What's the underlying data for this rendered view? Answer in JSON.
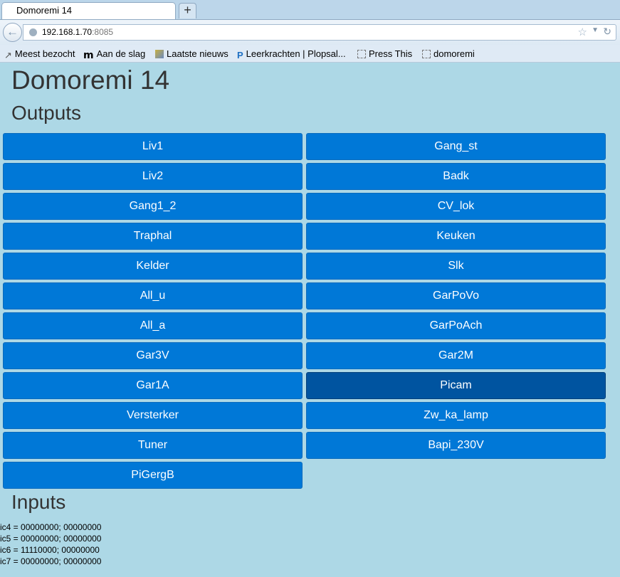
{
  "browser": {
    "tab_title": "Domoremi 14",
    "new_tab": "+",
    "url_host": "192.168.1.70",
    "url_port": ":8085",
    "bookmarks": [
      {
        "label": "Meest bezocht",
        "icon": "most-visited-icon"
      },
      {
        "label": "Aan de slag",
        "icon": "m-logo-icon"
      },
      {
        "label": "Laatste nieuws",
        "icon": "news-feed-icon"
      },
      {
        "label": "Leerkrachten | Plopsal...",
        "icon": "p-logo-icon"
      },
      {
        "label": "Press This",
        "icon": "blank-page-icon"
      },
      {
        "label": "domoremi",
        "icon": "blank-page-icon"
      }
    ]
  },
  "page": {
    "title": "Domoremi 14",
    "outputs_heading": "Outputs",
    "inputs_heading": "Inputs",
    "outputs": [
      {
        "label": "Liv1",
        "active": false
      },
      {
        "label": "Gang_st",
        "active": false
      },
      {
        "label": "Liv2",
        "active": false
      },
      {
        "label": "Badk",
        "active": false
      },
      {
        "label": "Gang1_2",
        "active": false
      },
      {
        "label": "CV_lok",
        "active": false
      },
      {
        "label": "Traphal",
        "active": false
      },
      {
        "label": "Keuken",
        "active": false
      },
      {
        "label": "Kelder",
        "active": false
      },
      {
        "label": "Slk",
        "active": false
      },
      {
        "label": "All_u",
        "active": false
      },
      {
        "label": "GarPoVo",
        "active": false
      },
      {
        "label": "All_a",
        "active": false
      },
      {
        "label": "GarPoAch",
        "active": false
      },
      {
        "label": "Gar3V",
        "active": false
      },
      {
        "label": "Gar2M",
        "active": false
      },
      {
        "label": "Gar1A",
        "active": false
      },
      {
        "label": "Picam",
        "active": true
      },
      {
        "label": "Versterker",
        "active": false
      },
      {
        "label": "Zw_ka_lamp",
        "active": false
      },
      {
        "label": "Tuner",
        "active": false
      },
      {
        "label": "Bapi_230V",
        "active": false
      },
      {
        "label": "PiGergB",
        "active": false
      }
    ],
    "inputs": [
      "ic4 = 00000000; 00000000",
      "ic5 = 00000000; 00000000",
      "ic6 = 11110000; 00000000",
      "ic7 = 00000000; 00000000"
    ]
  },
  "colors": {
    "background": "#add8e6",
    "button": "#0078d7",
    "button_active": "#0054a0"
  }
}
